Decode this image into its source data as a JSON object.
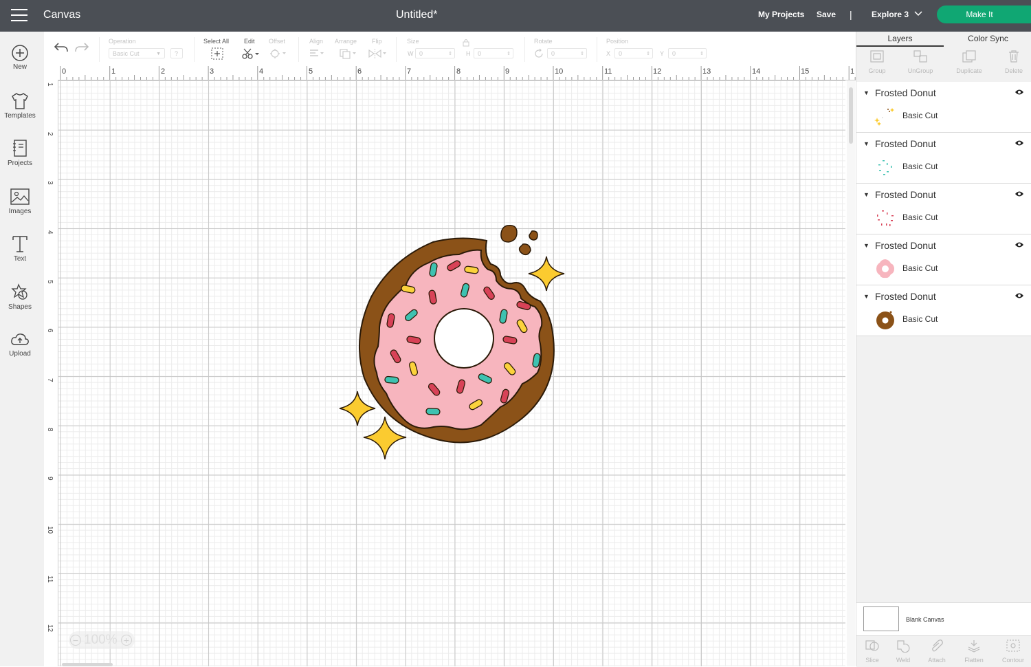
{
  "header": {
    "app_name": "Canvas",
    "doc_title": "Untitled*",
    "my_projects": "My Projects",
    "save": "Save",
    "separator": "|",
    "machine": "Explore 3",
    "make_it": "Make It"
  },
  "sidebar": {
    "items": [
      {
        "label": "New",
        "icon": "plus-circle-icon"
      },
      {
        "label": "Templates",
        "icon": "tshirt-icon"
      },
      {
        "label": "Projects",
        "icon": "notebook-icon"
      },
      {
        "label": "Images",
        "icon": "image-icon"
      },
      {
        "label": "Text",
        "icon": "text-icon"
      },
      {
        "label": "Shapes",
        "icon": "shapes-icon"
      },
      {
        "label": "Upload",
        "icon": "cloud-upload-icon"
      }
    ]
  },
  "toolbar": {
    "operation_label": "Operation",
    "operation_value": "Basic Cut",
    "help": "?",
    "select_all": "Select All",
    "edit": "Edit",
    "offset": "Offset",
    "align": "Align",
    "arrange": "Arrange",
    "flip": "Flip",
    "size": "Size",
    "w_label": "W",
    "h_label": "H",
    "w_value": "0",
    "h_value": "0",
    "rotate": "Rotate",
    "rotate_value": "0",
    "position": "Position",
    "x_label": "X",
    "y_label": "Y",
    "x_value": "0",
    "y_value": "0"
  },
  "ruler": {
    "h": [
      "0",
      "1",
      "2",
      "3",
      "4",
      "5",
      "6",
      "7",
      "8",
      "9",
      "10",
      "11",
      "12",
      "13",
      "14",
      "15",
      "1"
    ],
    "v": [
      "1",
      "2",
      "3",
      "4",
      "5",
      "6",
      "7",
      "8",
      "9",
      "10",
      "11",
      "12"
    ]
  },
  "zoom": {
    "minus": "−",
    "value": "100%",
    "plus": "+"
  },
  "panel": {
    "tabs": [
      "Layers",
      "Color Sync"
    ],
    "tools": [
      "Group",
      "UnGroup",
      "Duplicate",
      "Delete"
    ],
    "layers": [
      {
        "name": "Frosted Donut",
        "op": "Basic Cut",
        "thumb": "yellow-sparkles"
      },
      {
        "name": "Frosted Donut",
        "op": "Basic Cut",
        "thumb": "teal-sprinkles"
      },
      {
        "name": "Frosted Donut",
        "op": "Basic Cut",
        "thumb": "red-sprinkles"
      },
      {
        "name": "Frosted Donut",
        "op": "Basic Cut",
        "thumb": "pink-frosting"
      },
      {
        "name": "Frosted Donut",
        "op": "Basic Cut",
        "thumb": "brown-donut"
      }
    ],
    "blank_canvas": "Blank Canvas",
    "bottom_tools": [
      "Slice",
      "Weld",
      "Attach",
      "Flatten",
      "Contour"
    ]
  },
  "colors": {
    "topbar": "#4b4f55",
    "make_it": "#10a773",
    "donut_brown": "#8b5218",
    "frosting_pink": "#f7b5be",
    "sprinkle_red": "#d84257",
    "sprinkle_teal": "#3ec2b1",
    "sprinkle_yellow": "#fbd23c",
    "sparkle_yellow": "#fbcb30"
  }
}
